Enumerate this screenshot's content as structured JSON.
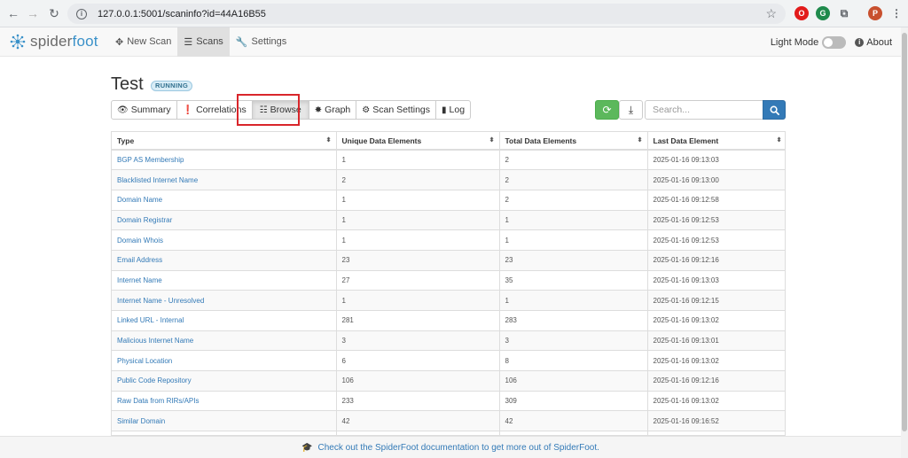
{
  "browser": {
    "url": "127.0.0.1:5001/scaninfo?id=44A16B55",
    "back_icon": "←",
    "forward_icon": "→",
    "reload_icon": "↻",
    "star_icon": "☆",
    "profile_letter": "P"
  },
  "navbar": {
    "brand_part1": "spider",
    "brand_part2": "foot",
    "items": [
      {
        "label": "New Scan",
        "icon": "✥"
      },
      {
        "label": "Scans",
        "icon": "☰"
      },
      {
        "label": "Settings",
        "icon": "🔧"
      }
    ],
    "light_mode_label": "Light Mode",
    "about_label": "About",
    "about_icon": "i"
  },
  "scan": {
    "title": "Test",
    "status": "RUNNING"
  },
  "tabs": [
    {
      "label": "Summary",
      "icon": "👁"
    },
    {
      "label": "Correlations",
      "icon": "❗"
    },
    {
      "label": "Browse",
      "icon": "☷"
    },
    {
      "label": "Graph",
      "icon": "✸"
    },
    {
      "label": "Scan Settings",
      "icon": "⚙"
    },
    {
      "label": "Log",
      "icon": "▮"
    }
  ],
  "controls": {
    "refresh_icon": "⟳",
    "download_icon": "⤓",
    "search_placeholder": "Search..."
  },
  "table": {
    "headers": [
      "Type",
      "Unique Data Elements",
      "Total Data Elements",
      "Last Data Element"
    ],
    "sort_icon": "⬍",
    "rows": [
      [
        "BGP AS Membership",
        "1",
        "2",
        "2025-01-16 09:13:03"
      ],
      [
        "Blacklisted Internet Name",
        "2",
        "2",
        "2025-01-16 09:13:00"
      ],
      [
        "Domain Name",
        "1",
        "2",
        "2025-01-16 09:12:58"
      ],
      [
        "Domain Registrar",
        "1",
        "1",
        "2025-01-16 09:12:53"
      ],
      [
        "Domain Whois",
        "1",
        "1",
        "2025-01-16 09:12:53"
      ],
      [
        "Email Address",
        "23",
        "23",
        "2025-01-16 09:12:16"
      ],
      [
        "Internet Name",
        "27",
        "35",
        "2025-01-16 09:13:03"
      ],
      [
        "Internet Name - Unresolved",
        "1",
        "1",
        "2025-01-16 09:12:15"
      ],
      [
        "Linked URL - Internal",
        "281",
        "283",
        "2025-01-16 09:13:02"
      ],
      [
        "Malicious Internet Name",
        "3",
        "3",
        "2025-01-16 09:13:01"
      ],
      [
        "Physical Location",
        "6",
        "8",
        "2025-01-16 09:13:02"
      ],
      [
        "Public Code Repository",
        "106",
        "106",
        "2025-01-16 09:12:16"
      ],
      [
        "Raw Data from RIRs/APIs",
        "233",
        "309",
        "2025-01-16 09:13:02"
      ],
      [
        "Similar Domain",
        "42",
        "42",
        "2025-01-16 09:16:52"
      ],
      [
        "",
        "",
        "",
        ""
      ]
    ]
  },
  "footer": {
    "text": "Check out the SpiderFoot documentation to get more out of SpiderFoot.",
    "icon": "🎓"
  }
}
